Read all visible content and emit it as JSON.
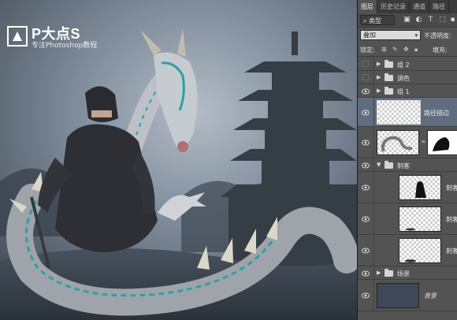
{
  "logo": {
    "title": "P大点S",
    "subtitle": "专注Photoshop教程"
  },
  "panel": {
    "tabs": [
      "图层",
      "历史记录",
      "通道",
      "路径"
    ],
    "active_tab": 0,
    "filter_kind": "类型",
    "blend_mode": "叠加",
    "opacity_label": "不透明度:",
    "lock_label": "锁定:",
    "fill_label": "填充:",
    "layers": [
      {
        "name": "组 2",
        "kind": "group",
        "visible": false
      },
      {
        "name": "调色",
        "kind": "group",
        "visible": false
      },
      {
        "name": "组 1",
        "kind": "group",
        "visible": true
      },
      {
        "name": "路径描边",
        "kind": "layer",
        "visible": true,
        "selected": true
      },
      {
        "name": "",
        "kind": "masked",
        "visible": true
      },
      {
        "name": "刺客",
        "kind": "group-open",
        "visible": true
      },
      {
        "name": "刺客",
        "kind": "layer-sub",
        "visible": true
      },
      {
        "name": "刺客",
        "kind": "layer-sub",
        "visible": true
      },
      {
        "name": "刺客",
        "kind": "layer-sub",
        "visible": true
      },
      {
        "name": "场景",
        "kind": "group",
        "visible": true
      },
      {
        "name": "背景",
        "kind": "background",
        "visible": true
      }
    ]
  },
  "colors": {
    "accent": "#5f6d7f",
    "teal": "#1fa3a3",
    "sky": "#6d7b8a"
  }
}
